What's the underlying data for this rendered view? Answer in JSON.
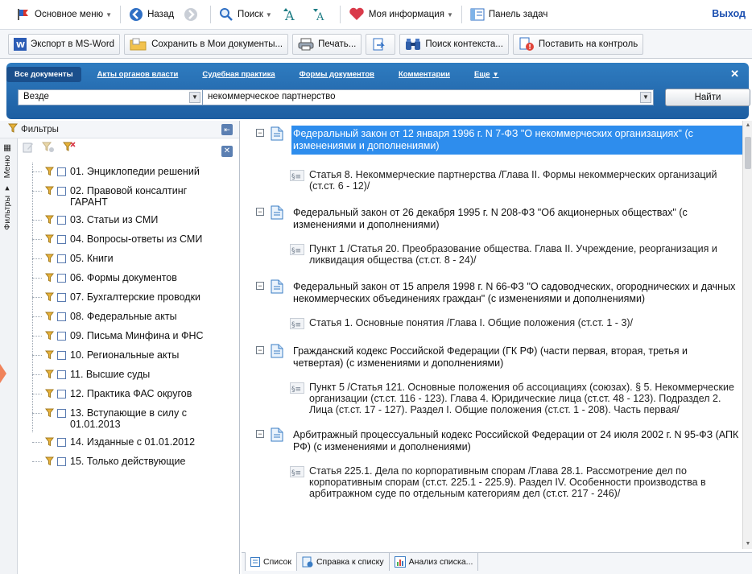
{
  "toolbar1": {
    "main_menu": "Основное меню",
    "back": "Назад",
    "search": "Поиск",
    "my_info": "Моя информация",
    "taskbar": "Панель задач",
    "exit": "Выход"
  },
  "toolbar2": {
    "export_word": "Экспорт в MS-Word",
    "save_docs": "Сохранить в Мои документы...",
    "print": "Печать...",
    "context_search": "Поиск контекста...",
    "set_control": "Поставить на контроль"
  },
  "search_panel": {
    "tabs": [
      "Все документы",
      "Акты органов власти",
      "Судебная практика",
      "Формы документов",
      "Комментарии",
      "Еще"
    ],
    "scope": "Везде",
    "query": "некоммерческое партнерство",
    "find_button": "Найти"
  },
  "left_panel": {
    "title": "Фильтры",
    "vtab_menu": "Меню",
    "vtab_filters": "Фильтры",
    "filters": [
      "01. Энциклопедии решений",
      "02. Правовой консалтинг ГАРАНТ",
      "03. Статьи из СМИ",
      "04. Вопросы-ответы из СМИ",
      "05. Книги",
      "06. Формы документов",
      "07. Бухгалтерские проводки",
      "08. Федеральные акты",
      "09. Письма Минфина и ФНС",
      "10. Региональные акты",
      "11. Высшие суды",
      "12. Практика ФАС округов",
      "13. Вступающие в силу с 01.01.2013",
      "14. Изданные с 01.01.2012",
      "15. Только действующие"
    ]
  },
  "results": [
    {
      "title": "Федеральный закон от 12 января 1996 г. N 7-ФЗ \"О некоммерческих организациях\" (с изменениями и дополнениями)",
      "fragment": "Статья 8. Некоммерческие партнерства /Глава II. Формы некоммерческих организаций (ст.ст. 6 - 12)/"
    },
    {
      "title": "Федеральный закон от 26 декабря 1995 г. N 208-ФЗ \"Об акционерных обществах\" (с изменениями и дополнениями)",
      "fragment": "Пункт 1 /Статья 20. Преобразование общества. Глава II. Учреждение, реорганизация и ликвидация общества (ст.ст. 8 - 24)/"
    },
    {
      "title": "Федеральный закон от 15 апреля 1998 г. N 66-ФЗ \"О садоводческих, огороднических и дачных некоммерческих объединениях граждан\" (с изменениями и дополнениями)",
      "fragment": "Статья 1. Основные понятия /Глава I. Общие положения (ст.ст. 1 - 3)/"
    },
    {
      "title": "Гражданский кодекс Российской Федерации (ГК РФ) (части первая, вторая, третья и четвертая) (с изменениями и дополнениями)",
      "fragment": "Пункт 5 /Статья 121. Основные положения об ассоциациях (союзах). § 5. Некоммерческие организации (ст.ст. 116 - 123). Глава 4. Юридические лица (ст.ст. 48 - 123). Подраздел 2. Лица (ст.ст. 17 - 127). Раздел I. Общие положения (ст.ст. 1 - 208). Часть первая/"
    },
    {
      "title": "Арбитражный процессуальный кодекс Российской Федерации от 24 июля 2002 г. N 95-ФЗ (АПК РФ) (с изменениями и дополнениями)",
      "fragment": "Статья 225.1. Дела по корпоративным спорам /Глава 28.1. Рассмотрение дел по корпоративным спорам (ст.ст. 225.1 - 225.9). Раздел IV. Особенности производства в арбитражном суде по отдельным категориям дел (ст.ст. 217 - 246)/"
    }
  ],
  "bottom_tabs": {
    "list": "Список",
    "list_help": "Справка к списку",
    "list_analysis": "Анализ списка..."
  }
}
